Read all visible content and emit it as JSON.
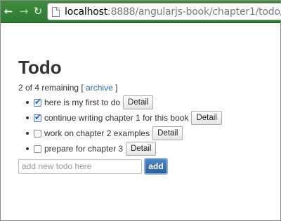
{
  "browser": {
    "url_host": "localhost",
    "url_path": ":8888/angularjs-book/chapter1/todo/",
    "back_icon": "back-arrow-icon",
    "forward_icon": "forward-arrow-icon",
    "reload_icon": "reload-icon",
    "page_icon": "page-icon"
  },
  "page": {
    "title": "Todo",
    "remaining_text": "2 of 4 remaining [",
    "archive_label": "archive",
    "bracket_close": "]"
  },
  "todos": [
    {
      "text": "here is my first to do",
      "done": true,
      "detail_label": "Detail"
    },
    {
      "text": "continue writing chapter 1 for this book",
      "done": true,
      "detail_label": "Detail"
    },
    {
      "text": "work on chapter 2 examples",
      "done": false,
      "detail_label": "Detail"
    },
    {
      "text": "prepare for chapter 3",
      "done": false,
      "detail_label": "Detail"
    }
  ],
  "add_form": {
    "input_value": "",
    "placeholder": "add new todo here",
    "add_label": "add"
  },
  "colors": {
    "toolbar": "#2f7a33",
    "link": "#2a6fb5",
    "add_button": "#2c5f99"
  }
}
